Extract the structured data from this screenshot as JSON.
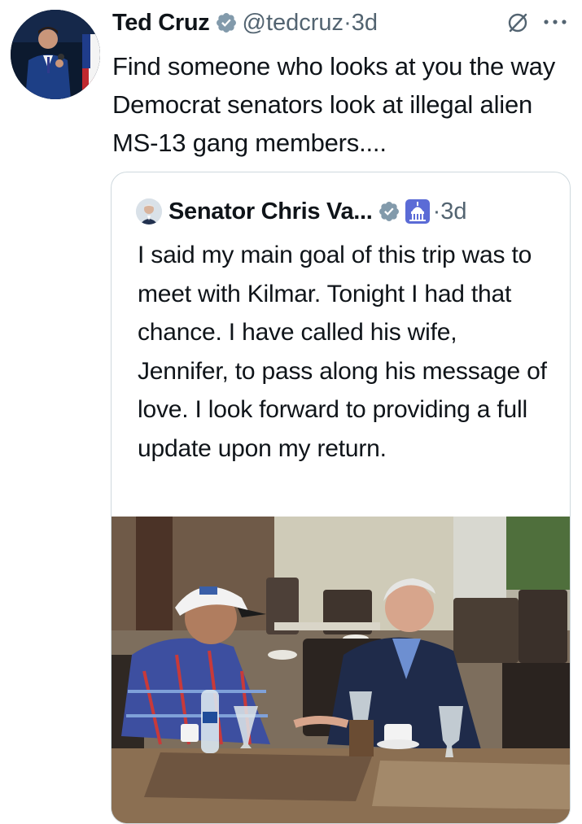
{
  "tweet": {
    "author_name": "Ted Cruz",
    "handle": "@tedcruz",
    "separator": "·",
    "time": "3d",
    "text": "Find someone who looks at you the way Democrat senators look at illegal alien MS-13 gang members....",
    "verified_color": "#829aab"
  },
  "quoted_tweet": {
    "author_name": "Senator Chris Va...",
    "separator": "·",
    "time": "3d",
    "text": "I said my main goal of this trip was to meet with Kilmar. Tonight I had that chance. I have called his wife, Jennifer, to pass along his message of love. I look forward to providing a full update upon my return.",
    "affiliation_badge": "capitol-icon",
    "affiliation_color": "#5b6bd6"
  },
  "colors": {
    "text": "#0f1419",
    "secondary": "#536471",
    "border": "#cfd9de"
  }
}
